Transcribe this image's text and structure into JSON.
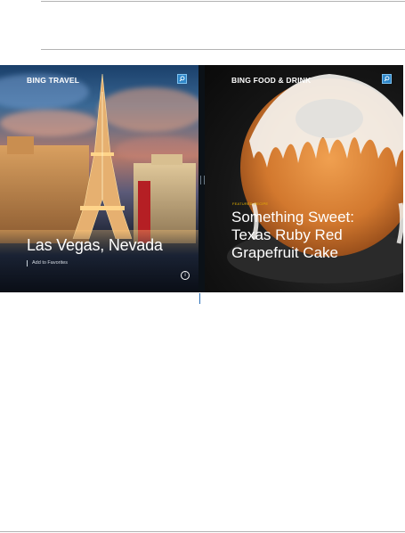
{
  "left_app": {
    "title": "BING TRAVEL",
    "headline": "Las Vegas, Nevada",
    "favorites_label": "Add to Favorites",
    "search_icon": "search-icon",
    "info_icon": "info-icon",
    "info_glyph": "i"
  },
  "right_app": {
    "title": "BING FOOD & DRINK",
    "feature_tag": "FEATURED RECIPE",
    "headline_line1": "Something Sweet:",
    "headline_line2": "Texas Ruby Red",
    "headline_line3": "Grapefruit Cake",
    "search_icon": "search-icon"
  },
  "colors": {
    "accent_blue": "#2e86c8",
    "feature_tag": "#e8b400",
    "rule": "#b3b3b3"
  }
}
